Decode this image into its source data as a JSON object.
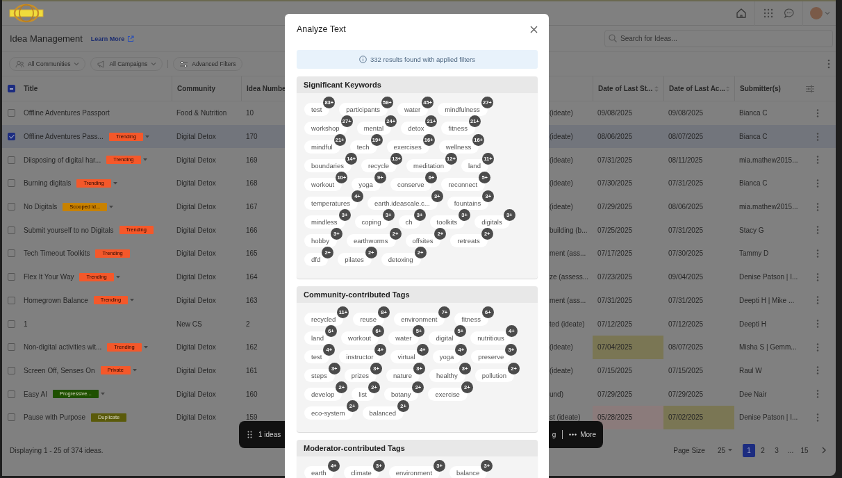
{
  "header": {
    "title": "Idea Management",
    "learn_more": "Learn More",
    "search": {
      "placeholder": "Search for Ideas..."
    }
  },
  "filters": [
    {
      "label": "All Communities",
      "kind": "communities"
    },
    {
      "label": "All Campaigns",
      "kind": "campaigns"
    },
    {
      "label": "Advanced Filters",
      "kind": "advanced"
    }
  ],
  "table": {
    "header_checkbox": {
      "partial": true
    },
    "columns": [
      {
        "label": "Title",
        "sortable": false
      },
      {
        "label": "Community",
        "sortable": false
      },
      {
        "label": "Idea Numbe"
      },
      {
        "label": "Date of Last St...",
        "sortable": true
      },
      {
        "label": "Date of Last Ac...",
        "sortable": true
      },
      {
        "label": "Submitter(s)",
        "sortable": false
      }
    ],
    "rows": [
      {
        "checked": false,
        "title": "Offline Adventures Passport",
        "community": "Food & Nutrition",
        "number": "10",
        "column_4": "(ideate)",
        "date_status": {
          "text": "09/08/2025"
        },
        "date_activity": {
          "text": "09/08/2025"
        },
        "submitter": "Bianca C"
      },
      {
        "checked": true,
        "title": "Offline Adventures Pass...",
        "badge": {
          "label": "Trending",
          "color": "#f4582a",
          "dropdown": true
        },
        "community": "Digital Detox",
        "number": "170",
        "column_4": "(ideate)",
        "date_status": {
          "text": "08/06/2025"
        },
        "date_activity": {
          "text": "08/07/2025"
        },
        "submitter": "Bianca C"
      },
      {
        "checked": false,
        "title": "Diisposing of digital har...",
        "badge": {
          "label": "Trending",
          "color": "#f4582a",
          "dropdown": true
        },
        "community": "Digital Detox",
        "number": "169",
        "column_4": "(ideate)",
        "date_status": {
          "text": "07/31/2025"
        },
        "date_activity": {
          "text": "08/11/2025"
        },
        "submitter": "mia.mathew2015..."
      },
      {
        "checked": false,
        "title": "Burning digitals",
        "badge": {
          "label": "Trending",
          "color": "#f4582a",
          "dropdown": true
        },
        "community": "Digital Detox",
        "number": "168",
        "column_4": "(ideate)",
        "date_status": {
          "text": "07/30/2025"
        },
        "date_activity": {
          "text": "07/31/2025"
        },
        "submitter": "Bianca C"
      },
      {
        "checked": false,
        "title": "No Digitals",
        "badge": {
          "label": "Scooped id...",
          "color": "#c88200",
          "dropdown": true
        },
        "community": "Digital Detox",
        "number": "167",
        "column_4": "(ideate)",
        "date_status": {
          "text": "07/29/2025"
        },
        "date_activity": {
          "text": "08/06/2025"
        },
        "submitter": "mia.mathew2015..."
      },
      {
        "checked": false,
        "title": "Submit yourself to no Digitals",
        "badge": {
          "label": "Trending",
          "color": "#f4582a",
          "dropdown": false
        },
        "community": "Digital Detox",
        "number": "166",
        "column_4": "building (b...",
        "date_status": {
          "text": "07/25/2025"
        },
        "date_activity": {
          "text": "07/31/2025"
        },
        "submitter": "Stacy G"
      },
      {
        "checked": false,
        "title": "Tech Timeout Toolkits",
        "badge": {
          "label": "Trending",
          "color": "#f4582a",
          "dropdown": false
        },
        "community": "Digital Detox",
        "number": "165",
        "column_4": "ment (ass...",
        "date_status": {
          "text": "07/17/2025"
        },
        "date_activity": {
          "text": "07/30/2025"
        },
        "submitter": "Tammy D"
      },
      {
        "checked": false,
        "title": "Flex It Your Way",
        "badge": {
          "label": "Trending",
          "color": "#f4582a",
          "dropdown": true
        },
        "community": "Digital Detox",
        "number": "164",
        "column_4": "ze (assess...",
        "date_status": {
          "text": "07/23/2025"
        },
        "date_activity": {
          "text": "09/04/2025"
        },
        "submitter": "Denise Patson | I..."
      },
      {
        "checked": false,
        "title": "Homegrown Balance",
        "badge": {
          "label": "Trending",
          "color": "#f4582a",
          "dropdown": true
        },
        "community": "Digital Detox",
        "number": "163",
        "column_4": "ment (ass...",
        "date_status": {
          "text": "07/31/2025"
        },
        "date_activity": {
          "text": "07/31/2025"
        },
        "submitter": "Deepti H | Mike ..."
      },
      {
        "checked": false,
        "title": "1",
        "community": "New CS",
        "number": "2",
        "column_4": "ted (ideate)",
        "date_status": {
          "text": "07/12/2025"
        },
        "date_activity": {
          "text": "07/12/2025"
        },
        "submitter": "Deepti H"
      },
      {
        "checked": false,
        "title": "Non-digital activities wit...",
        "badge": {
          "label": "Trending",
          "color": "#f4582a",
          "dropdown": true
        },
        "community": "Digital Detox",
        "number": "162",
        "column_4": "(ideate)",
        "date_status": {
          "text": "07/04/2025",
          "color": "#7a7654"
        },
        "date_activity": {
          "text": "08/07/2025"
        },
        "submitter": "Misha S | Gemm..."
      },
      {
        "checked": false,
        "title": "Screen Off, Senses On",
        "badge": {
          "label": "Private",
          "color": "#f4582a",
          "dropdown": true
        },
        "community": "Digital Detox",
        "number": "161",
        "column_4": "(ideate)",
        "date_status": {
          "text": "07/15/2025"
        },
        "date_activity": {
          "text": "07/15/2025"
        },
        "submitter": "Raul W"
      },
      {
        "checked": false,
        "title": "Easy AI",
        "badge": {
          "label": "Progressive...",
          "color": "#1e5000",
          "dropdown": true
        },
        "community": "Digital Detox",
        "number": "160",
        "column_4": "und)",
        "date_status": {
          "text": "07/29/2025"
        },
        "date_activity": {
          "text": "07/29/2025"
        },
        "submitter": "Dee Nair"
      },
      {
        "checked": false,
        "title": "Pause with Purpose",
        "badge": {
          "label": "Duplicate",
          "color": "#5a5a0a",
          "dropdown": false
        },
        "community": "Digital Detox",
        "number": "159",
        "column_4": "st (ideate)",
        "date_status": {
          "text": "05/28/2025",
          "color": "#8b7b7b"
        },
        "date_activity": {
          "text": "07/02/2025",
          "color": "#7a7654"
        },
        "submitter": "Denise Patson | I..."
      }
    ]
  },
  "action_bar": {
    "count_text": "1 ideas",
    "fragment": "g",
    "more": "More"
  },
  "footer": {
    "summary": "Displaying 1 - 25 of 374 ideas.",
    "page_size_label": "Page Size",
    "page_size": "25",
    "pages": [
      {
        "label": "1",
        "selected": true
      },
      {
        "label": "2",
        "selected": false
      },
      {
        "label": "3",
        "selected": false
      },
      {
        "label": "...",
        "selected": false
      },
      {
        "label": "15",
        "selected": false
      }
    ]
  },
  "modal": {
    "title": "Analyze Text",
    "info": "332 results found with applied filters",
    "sections": [
      {
        "title": "Significant Keywords",
        "tags": [
          {
            "label": "test",
            "count": "83+"
          },
          {
            "label": "participants",
            "count": "58+"
          },
          {
            "label": "water",
            "count": "45+"
          },
          {
            "label": "mindfulness",
            "count": "27+"
          },
          {
            "label": "workshop",
            "count": "27+"
          },
          {
            "label": "mental",
            "count": "24+"
          },
          {
            "label": "detox",
            "count": "21+"
          },
          {
            "label": "fitness",
            "count": "21+"
          },
          {
            "label": "mindful",
            "count": "21+"
          },
          {
            "label": "tech",
            "count": "19+"
          },
          {
            "label": "exercises",
            "count": "16+"
          },
          {
            "label": "wellness",
            "count": "16+"
          },
          {
            "label": "boundaries",
            "count": "14+"
          },
          {
            "label": "recycle",
            "count": "13+"
          },
          {
            "label": "meditation",
            "count": "12+"
          },
          {
            "label": "land",
            "count": "11+"
          },
          {
            "label": "workout",
            "count": "10+"
          },
          {
            "label": "yoga",
            "count": "9+"
          },
          {
            "label": "conserve",
            "count": "6+"
          },
          {
            "label": "reconnect",
            "count": "5+"
          },
          {
            "label": "temperatures",
            "count": "4+"
          },
          {
            "label": "earth.ideascale.c...",
            "count": "3+"
          },
          {
            "label": "fountains",
            "count": "3+"
          },
          {
            "label": "mindless",
            "count": "3+"
          },
          {
            "label": "coping",
            "count": "3+"
          },
          {
            "label": "ch",
            "count": "3+"
          },
          {
            "label": "toolkits",
            "count": "3+"
          },
          {
            "label": "digitals",
            "count": "3+"
          },
          {
            "label": "hobby",
            "count": "3+"
          },
          {
            "label": "earthworms",
            "count": "2+"
          },
          {
            "label": "offsites",
            "count": "2+"
          },
          {
            "label": "retreats",
            "count": "2+"
          },
          {
            "label": "dfd",
            "count": "2+"
          },
          {
            "label": "pilates",
            "count": "2+"
          },
          {
            "label": "detoxing",
            "count": "2+"
          }
        ]
      },
      {
        "title": "Community-contributed Tags",
        "tags": [
          {
            "label": "recycled",
            "count": "11+"
          },
          {
            "label": "reuse",
            "count": "8+"
          },
          {
            "label": "environment",
            "count": "7+"
          },
          {
            "label": "fitness",
            "count": "6+"
          },
          {
            "label": "land",
            "count": "6+"
          },
          {
            "label": "workout",
            "count": "6+"
          },
          {
            "label": "water",
            "count": "5+"
          },
          {
            "label": "digital",
            "count": "5+"
          },
          {
            "label": "nutritious",
            "count": "4+"
          },
          {
            "label": "test",
            "count": "4+"
          },
          {
            "label": "instructor",
            "count": "4+"
          },
          {
            "label": "virtual",
            "count": "4+"
          },
          {
            "label": "yoga",
            "count": "4+"
          },
          {
            "label": "preserve",
            "count": "3+"
          },
          {
            "label": "steps",
            "count": "3+"
          },
          {
            "label": "prizes",
            "count": "3+"
          },
          {
            "label": "nature",
            "count": "3+"
          },
          {
            "label": "healthy",
            "count": "3+"
          },
          {
            "label": "pollution",
            "count": "2+"
          },
          {
            "label": "develop",
            "count": "2+"
          },
          {
            "label": "list",
            "count": "2+"
          },
          {
            "label": "botany",
            "count": "2+"
          },
          {
            "label": "exercise",
            "count": "2+"
          },
          {
            "label": "eco-system",
            "count": "2+"
          },
          {
            "label": "balanced",
            "count": "2+"
          }
        ]
      },
      {
        "title": "Moderator-contributed Tags",
        "tags": [
          {
            "label": "earth",
            "count": "4+"
          },
          {
            "label": "climate",
            "count": "3+"
          },
          {
            "label": "environment",
            "count": "3+"
          },
          {
            "label": "balance",
            "count": "3+"
          }
        ]
      }
    ]
  }
}
